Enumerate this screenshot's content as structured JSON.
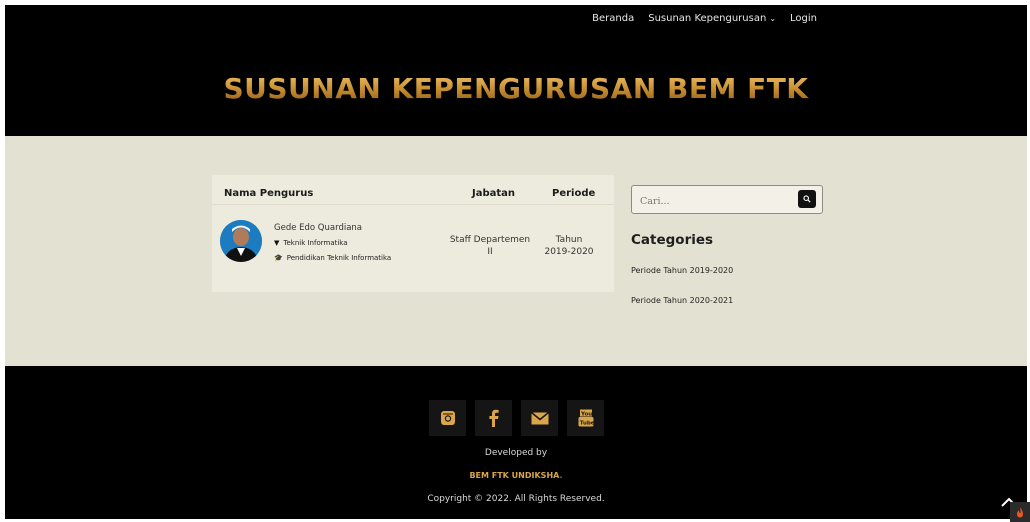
{
  "nav": {
    "items": [
      {
        "label": "Beranda"
      },
      {
        "label": "Susunan Kepengurusan",
        "has_dropdown": true
      },
      {
        "label": "Login"
      }
    ]
  },
  "header": {
    "title": "SUSUNAN KEPENGURUSAN BEM FTK"
  },
  "table": {
    "columns": [
      "Nama Pengurus",
      "Jabatan",
      "Periode"
    ],
    "rows": [
      {
        "name": "Gede Edo Quardiana",
        "study_program": "Teknik Informatika",
        "study_icon": "filter-icon",
        "major": "Pendidikan Teknik Informatika",
        "major_icon": "graduation-cap-icon",
        "jabatan": "Staff Departemen II",
        "periode": "Tahun 2019-2020"
      }
    ]
  },
  "sidebar": {
    "search_placeholder": "Cari...",
    "categories_title": "Categories",
    "categories": [
      {
        "label": "Periode Tahun 2019-2020"
      },
      {
        "label": "Periode Tahun 2020-2021"
      }
    ]
  },
  "footer": {
    "social_icons": [
      "instagram-icon",
      "facebook-icon",
      "email-icon",
      "youtube-icon"
    ],
    "developed_by": "Developed by",
    "brand_part1": "BEM FTK UNDIKSHA",
    "brand_part2": ".",
    "copyright": "Copyright © 2022. All Rights Reserved."
  },
  "colors": {
    "header_bg": "#000000",
    "content_bg": "#e3e2d2",
    "accent_gold": "#c48a2e"
  }
}
